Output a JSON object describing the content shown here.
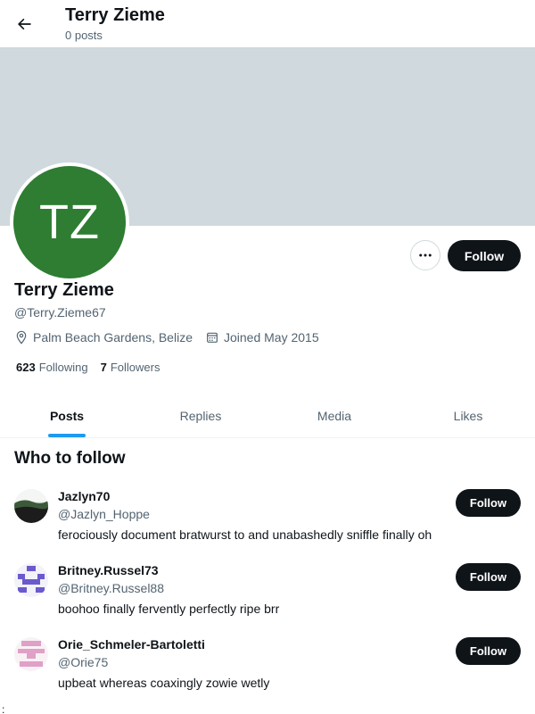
{
  "header": {
    "title": "Terry Zieme",
    "post_count": "0 posts"
  },
  "profile": {
    "initials": "TZ",
    "name": "Terry Zieme",
    "handle": "@Terry.Zieme67",
    "location": "Palm Beach Gardens, Belize",
    "joined": "Joined May 2015",
    "following_count": "623",
    "following_label": "Following",
    "followers_count": "7",
    "followers_label": "Followers",
    "follow_label": "Follow",
    "avatar_color": "#2e7d32",
    "banner_color": "#cfd9de"
  },
  "tabs": [
    {
      "label": "Posts",
      "active": true
    },
    {
      "label": "Replies",
      "active": false
    },
    {
      "label": "Media",
      "active": false
    },
    {
      "label": "Likes",
      "active": false
    }
  ],
  "who_to_follow": {
    "title": "Who to follow",
    "items": [
      {
        "name": "Jazlyn70",
        "handle": "@Jazlyn_Hoppe",
        "bio": "ferociously document bratwurst to and unabashedly sniffle finally oh",
        "follow_label": "Follow"
      },
      {
        "name": "Britney.Russel73",
        "handle": "@Britney.Russel88",
        "bio": "boohoo finally fervently perfectly ripe brr",
        "follow_label": "Follow"
      },
      {
        "name": "Orie_Schmeler-Bartoletti",
        "handle": "@Orie75",
        "bio": "upbeat whereas coaxingly zowie wetly",
        "follow_label": "Follow"
      }
    ]
  },
  "stray_char": ":",
  "colors": {
    "accent": "#1d9bf0",
    "text": "#0f1419",
    "muted": "#536471",
    "button": "#0f1419"
  }
}
